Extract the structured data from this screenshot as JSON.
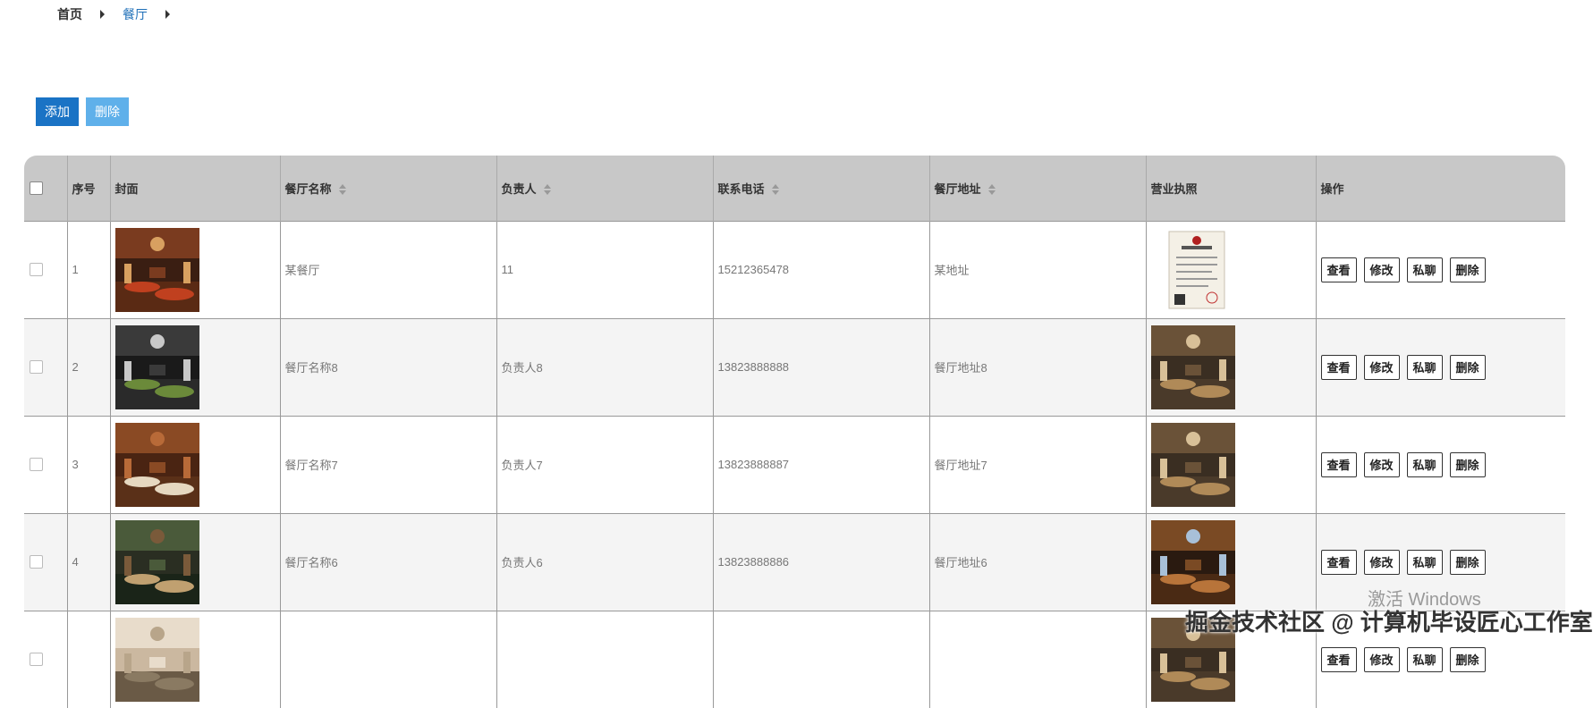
{
  "breadcrumb": {
    "home": "首页",
    "current": "餐厅"
  },
  "toolbar": {
    "add_label": "添加",
    "delete_label": "删除"
  },
  "table": {
    "headers": {
      "index": "序号",
      "cover": "封面",
      "name": "餐厅名称",
      "owner": "负责人",
      "phone": "联系电话",
      "address": "餐厅地址",
      "license": "营业执照",
      "actions": "操作"
    },
    "row_actions": {
      "view": "查看",
      "edit": "修改",
      "chat": "私聊",
      "delete": "删除"
    },
    "rows": [
      {
        "index": "1",
        "name": "某餐厅",
        "owner": "11",
        "phone": "15212365478",
        "address": "某地址",
        "cover_image": "restaurant-interior-red-lanterns",
        "license_image": "business-license-document"
      },
      {
        "index": "2",
        "name": "餐厅名称8",
        "owner": "负责人8",
        "phone": "13823888888",
        "address": "餐厅地址8",
        "cover_image": "buffet-food-counter",
        "license_image": "restaurant-dining-hall"
      },
      {
        "index": "3",
        "name": "餐厅名称7",
        "owner": "负责人7",
        "phone": "13823888887",
        "address": "餐厅地址7",
        "cover_image": "round-table-private-room",
        "license_image": "restaurant-dining-hall"
      },
      {
        "index": "4",
        "name": "餐厅名称6",
        "owner": "负责人6",
        "phone": "13823888886",
        "address": "餐厅地址6",
        "cover_image": "long-corridor-dining",
        "license_image": "restaurant-wood-interior"
      },
      {
        "index": "",
        "name": "",
        "owner": "",
        "phone": "",
        "address": "",
        "cover_image": "restaurant-light-interior",
        "license_image": "restaurant-dining-hall"
      }
    ]
  },
  "watermarks": {
    "windows": "激活 Windows",
    "csdn": "掘金技术社区 @ 计算机毕设匠心工作室"
  },
  "colors": {
    "primary": "#1a73c5",
    "secondary": "#5fb0ea",
    "header_bg": "#c8c8c8",
    "link": "#1e6fb8"
  }
}
